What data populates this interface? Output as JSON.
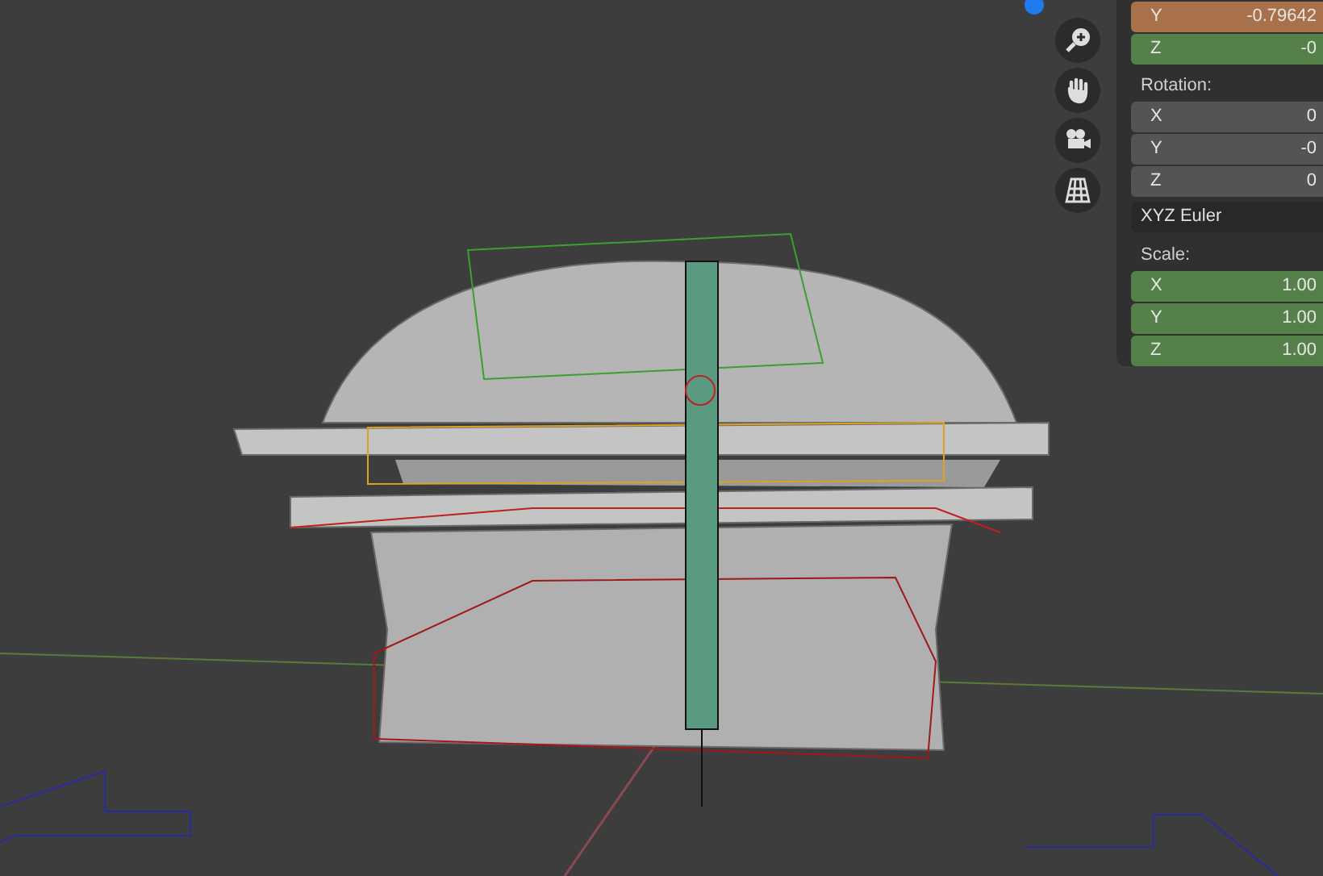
{
  "location_rows": [
    {
      "axis": "Y",
      "value": "-0.79642",
      "color": "#a8714a"
    },
    {
      "axis": "Z",
      "value": "-0",
      "color": "#56804a"
    }
  ],
  "rotation": {
    "label": "Rotation:",
    "rows": [
      {
        "axis": "X",
        "value": "0",
        "color": "#545454"
      },
      {
        "axis": "Y",
        "value": "-0",
        "color": "#545454"
      },
      {
        "axis": "Z",
        "value": "0",
        "color": "#545454"
      }
    ],
    "mode": "XYZ Euler"
  },
  "scale": {
    "label": "Scale:",
    "rows": [
      {
        "axis": "X",
        "value": "1.00",
        "color": "#56804a"
      },
      {
        "axis": "Y",
        "value": "1.00",
        "color": "#56804a"
      },
      {
        "axis": "Z",
        "value": "1.00",
        "color": "#56804a"
      }
    ]
  }
}
